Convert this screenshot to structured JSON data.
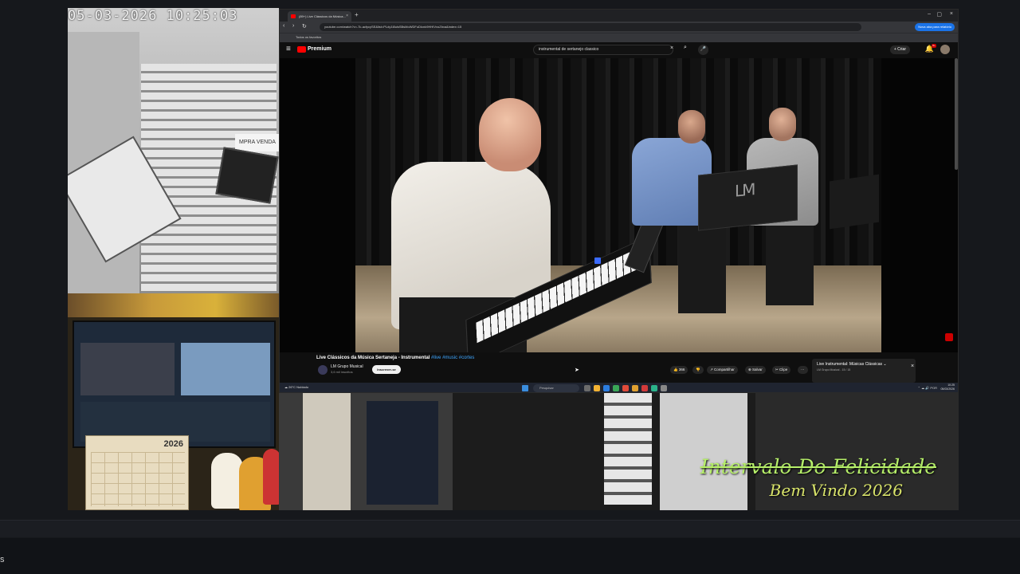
{
  "camera": {
    "timestamp": "05-03-2026 10:25:03",
    "shop_sign": "MPRA  VENDA",
    "calendar_year": "2026"
  },
  "browser": {
    "tab_title": "(89+) Live Clássicos da Música...",
    "tab_close": "×",
    "new_tab": "+",
    "window_controls": [
      "–",
      "▢",
      "×"
    ],
    "nav": [
      "‹",
      "›",
      "↻"
    ],
    "url": "youtube.com/watch?v=-Tc-acfycySE&list=PLdy1l8ulsSBsMoWDFuDIcnk9HHIVvoZbxa&index=15",
    "extension_button": "Nova aba para relatório",
    "bookmark": "Todos os favoritos"
  },
  "youtube": {
    "menu_icon": "≡",
    "brand": "Premium",
    "search_query": "instrumental de sertanejo classico",
    "search_clear": "×",
    "search_icon": "⌕",
    "mic_icon": "🎤",
    "create_label": "+ Criar",
    "bell_icon": "🔔",
    "notification_count": "9+",
    "video": {
      "stand_logo": "LM",
      "title": "Live Clássicos da Música Sertaneja - Instrumental",
      "tags": " #live #music #cortes",
      "channel": "LM Grupo Musical",
      "subscribers": "3,6 mil inscritos",
      "subscribe": "Inscrever-se",
      "actions": [
        "👍 366",
        "👎",
        "↗ Compartilhar",
        "⊕ Salvar",
        "✂ Clipe",
        "⋯"
      ]
    },
    "miniplayer": {
      "title": "Live Instrumental: Músicas Clássicas ⌄",
      "subtitle": "LM Grupo Musical - 15 / 15",
      "close": "×"
    }
  },
  "taskbar": {
    "weather": "☁ 26°C Nublado",
    "search_placeholder": "Pesquisar",
    "tray": "⌃ ☁ 🔊 POR",
    "time": "10:25",
    "date": "05/03/2026"
  },
  "overlay": {
    "line1": "Intervalo Do Felicidade",
    "line2": "Bem Vindo 2026"
  },
  "bottom": {
    "label": "s"
  }
}
